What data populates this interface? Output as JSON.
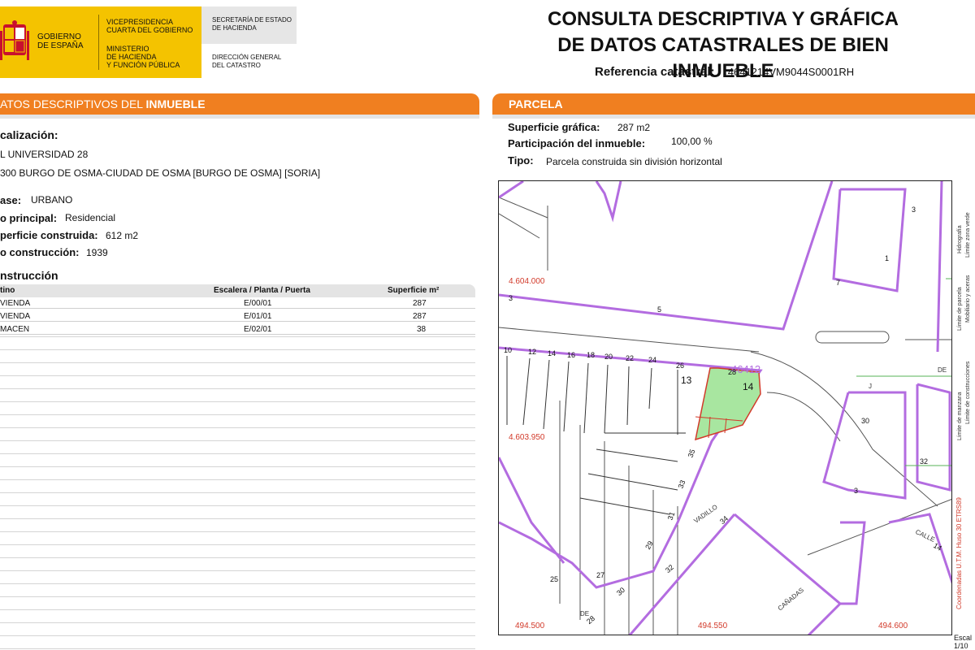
{
  "header": {
    "gob_line1": "GOBIERNO",
    "gob_line2": "DE ESPAÑA",
    "vice_line1": "VICEPRESIDENCIA",
    "vice_line2": "CUARTA DEL GOBIERNO",
    "min_line1": "MINISTERIO",
    "min_line2": "DE HACIENDA",
    "min_line3": "Y FUNCIÓN PÚBLICA",
    "sec_line1": "SECRETARÍA DE ESTADO",
    "sec_line2": "DE HACIENDA",
    "dir_line1": "DIRECCIÓN GENERAL",
    "dir_line2": "DEL CATASTRO",
    "title_line1": "CONSULTA DESCRIPTIVA Y GRÁFICA",
    "title_line2": "DE DATOS CATASTRALES DE BIEN INMUEBLE",
    "ref_label": "Referencia catastral:",
    "ref_value": "4641214VM9044S0001RH"
  },
  "left_section": {
    "bar_prefix": "ATOS DESCRIPTIVOS DEL ",
    "bar_bold": "INMUEBLE",
    "localizacion_label": "calización:",
    "address_line1": "L UNIVERSIDAD 28",
    "address_line2": "300 BURGO DE OSMA-CIUDAD DE OSMA [BURGO DE OSMA] [SORIA]",
    "clase_label": "ase:",
    "clase_value": "URBANO",
    "uso_label": "o principal:",
    "uso_value": "Residencial",
    "superficie_label": "perficie construida:",
    "superficie_value": "612 m2",
    "anio_label": "o construcción:",
    "anio_value": "1939",
    "construccion_label": "nstrucción",
    "table": {
      "headers": {
        "destino": "tino",
        "escalera": "Escalera / Planta / Puerta",
        "superficie": "Superficie m²"
      },
      "rows": [
        {
          "destino": "VIENDA",
          "escalera": "E/00/01",
          "superficie": "287"
        },
        {
          "destino": "VIENDA",
          "escalera": "E/01/01",
          "superficie": "287"
        },
        {
          "destino": "MACEN",
          "escalera": "E/02/01",
          "superficie": "38"
        }
      ]
    }
  },
  "right_section": {
    "bar_label": "PARCELA",
    "sup_grafica_label": "Superficie gráfica:",
    "sup_grafica_value": "287 m2",
    "participacion_label": "Participación del inmueble:",
    "participacion_value": "100,00 %",
    "tipo_label": "Tipo:",
    "tipo_value": "Parcela construida sin división horizontal"
  },
  "map": {
    "coord_y_top": "4.604.000",
    "coord_y_mid": "4.603.950",
    "coord_x_left": "494.500",
    "coord_x_mid": "494.550",
    "coord_x_right": "494.600",
    "parcel_ref": "46412",
    "parcel_number": "14",
    "neighbor_13": "13",
    "street_vadillo": "VADILLO",
    "street_calle": "CALLE",
    "street_canadas": "CAÑADAS",
    "street_de": "DE",
    "street_j": "J",
    "house_numbers_top": [
      "10",
      "12",
      "14",
      "16",
      "18",
      "20",
      "22",
      "24",
      "26",
      "28"
    ],
    "house_numbers_diag": [
      "35",
      "33",
      "31",
      "29",
      "27",
      "25"
    ],
    "house_numbers_lower": [
      "34",
      "32",
      "30",
      "28"
    ],
    "block_numbers": [
      "5",
      "3",
      "7",
      "1",
      "3",
      "30",
      "32",
      "3",
      "14",
      "13"
    ],
    "legend_items": [
      "Límite de manzana",
      "Límite de parcela",
      "Límite de construcciones",
      "Mobiliario y aceras",
      "Límite zona verde",
      "Hidrografía"
    ],
    "legend_coords": "Coordenadas U.T.M. Huso 30 ETRS89",
    "scale_label": "Escal",
    "scale_value": "1/10"
  },
  "colors": {
    "accent_orange": "#f07f20",
    "logo_yellow": "#f4c300",
    "parcel_green": "#a8e6a0",
    "block_purple": "#b36ce0",
    "coord_red": "#d23a2a"
  }
}
